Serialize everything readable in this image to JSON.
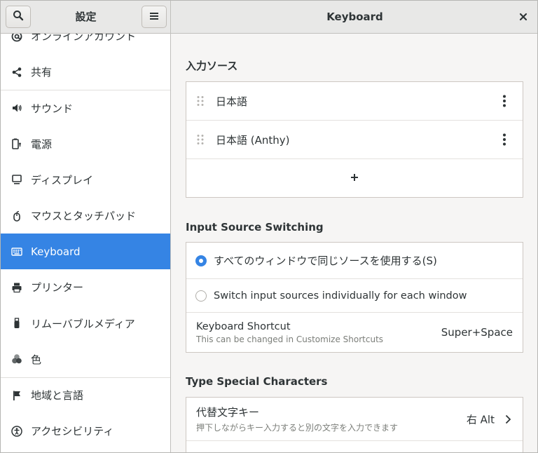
{
  "header": {
    "left_title": "設定",
    "right_title": "Keyboard",
    "search_icon": "search-icon",
    "menu_icon": "hamburger-menu-icon",
    "close_symbol": "✕"
  },
  "sidebar": {
    "items": [
      {
        "label": "オンラインアカウント",
        "icon": "at-icon"
      },
      {
        "label": "共有",
        "icon": "share-icon"
      },
      {
        "label": "サウンド",
        "icon": "speaker-icon"
      },
      {
        "label": "電源",
        "icon": "battery-icon"
      },
      {
        "label": "ディスプレイ",
        "icon": "display-icon"
      },
      {
        "label": "マウスとタッチパッド",
        "icon": "mouse-icon"
      },
      {
        "label": "Keyboard",
        "icon": "keyboard-icon",
        "active": true
      },
      {
        "label": "プリンター",
        "icon": "printer-icon"
      },
      {
        "label": "リムーバブルメディア",
        "icon": "usb-drive-icon"
      },
      {
        "label": "色",
        "icon": "color-icon"
      },
      {
        "label": "地域と言語",
        "icon": "flag-icon"
      },
      {
        "label": "アクセシビリティ",
        "icon": "accessibility-icon"
      }
    ]
  },
  "input_sources": {
    "title": "入力ソース",
    "sources": [
      {
        "label": "日本語"
      },
      {
        "label": "日本語 (Anthy)"
      }
    ],
    "add_symbol": "+"
  },
  "input_switching": {
    "title": "Input Source Switching",
    "options": [
      {
        "label": "すべてのウィンドウで同じソースを使用する(S)",
        "checked": true
      },
      {
        "label": "Switch input sources individually for each window",
        "checked": false
      }
    ],
    "shortcut": {
      "label": "Keyboard Shortcut",
      "sublabel": "This can be changed in Customize Shortcuts",
      "value": "Super+Space"
    }
  },
  "special_chars": {
    "title": "Type Special Characters",
    "alternate": {
      "label": "代替文字キー",
      "sublabel": "押下しながらキー入力すると別の文字を入力できます",
      "value": "右 Alt"
    }
  },
  "colors": {
    "accent": "#3584e4",
    "sidebar_bg": "#ffffff",
    "content_bg": "#f6f5f4",
    "header_bg": "#e8e8e7"
  }
}
